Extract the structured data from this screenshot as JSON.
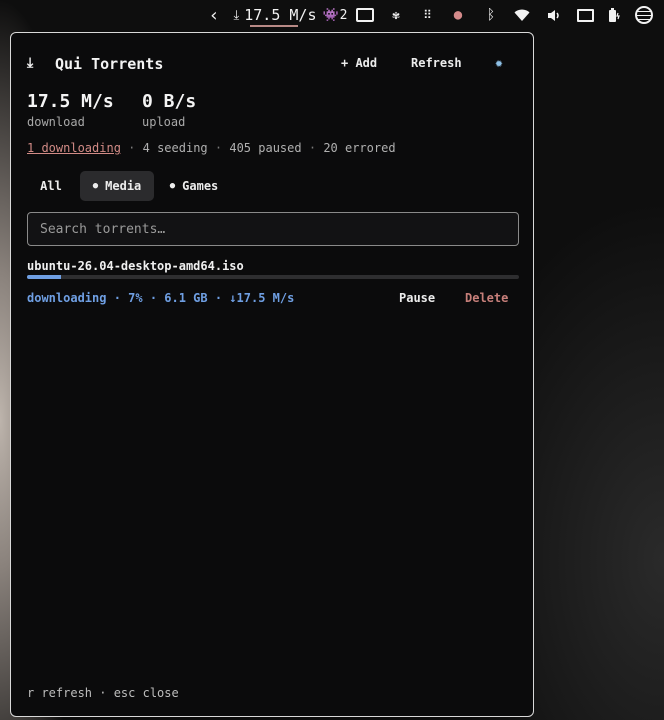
{
  "topbar": {
    "back_icon": "chevron-left-icon",
    "download_icon": "download-icon",
    "download_speed": "17.5 M/s",
    "discord_count": "2",
    "accent_color": "#b88a86"
  },
  "panel": {
    "title": "Qui Torrents",
    "title_icon": "download-icon",
    "add_label": "+ Add",
    "refresh_label": "Refresh",
    "settings_icon": "gear-icon",
    "stats": {
      "download_value": "17.5 M/s",
      "download_label": "download",
      "upload_value": "0 B/s",
      "upload_label": "upload"
    },
    "status": {
      "downloading": "1 downloading",
      "seeding": "4 seeding",
      "paused": "405 paused",
      "errored": "20 errored",
      "separator": "·"
    },
    "tabs": [
      {
        "label": "All",
        "active": false
      },
      {
        "label": "Media",
        "active": true
      },
      {
        "label": "Games",
        "active": false
      }
    ],
    "search": {
      "placeholder": "Search torrents…",
      "value": ""
    },
    "torrents": [
      {
        "name": "ubuntu-26.04-desktop-amd64.iso",
        "progress": 0.07,
        "meta": "downloading · 7% · 6.1 GB · ↓17.5 M/s",
        "pause_label": "Pause",
        "delete_label": "Delete"
      }
    ],
    "footer": "r refresh · esc close",
    "colors": {
      "progress": "#6f9fe3",
      "link": "#d28b86",
      "delete": "#c77f7a",
      "gear": "#8ec0e6"
    }
  }
}
